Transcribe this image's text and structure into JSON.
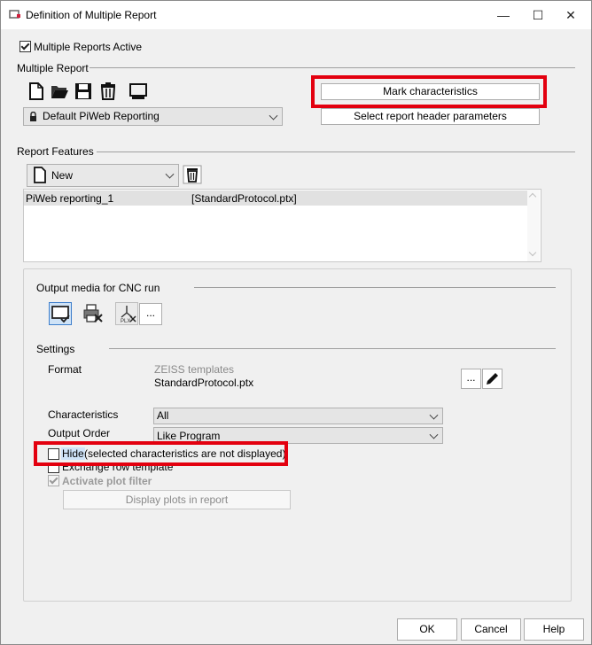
{
  "window": {
    "title": "Definition of Multiple Report",
    "minimize": "—",
    "maximize": "☐",
    "close": "✕"
  },
  "multiple_reports_active": {
    "label": "Multiple Reports Active",
    "checked": true
  },
  "multiple_report": {
    "section_label": "Multiple Report",
    "toolbar_icons": [
      "new-document-icon",
      "open-folder-icon",
      "save-icon",
      "delete-icon",
      "monitor-icon"
    ],
    "selected_report": "Default PiWeb Reporting",
    "mark_characteristics": "Mark characteristics",
    "select_header_params": "Select report header parameters"
  },
  "report_features": {
    "section_label": "Report Features",
    "new_combo": "New",
    "list": [
      {
        "name": "PiWeb reporting_1",
        "template": "[StandardProtocol.ptx]"
      }
    ]
  },
  "output_media": {
    "section_label": "Output media for CNC run",
    "icons": [
      "screen-output-icon",
      "printer-off-icon",
      "plx-export-icon"
    ],
    "more": "..."
  },
  "settings": {
    "section_label": "Settings",
    "format_label": "Format",
    "format_group": "ZEISS templates",
    "format_file": "StandardProtocol.ptx",
    "format_more": "...",
    "characteristics_label": "Characteristics",
    "characteristics_value": "All",
    "output_order_label": "Output Order",
    "output_order_value": "Like Program",
    "hide_word": "Hide",
    "hide_rest": " (selected characteristics are not displayed)",
    "exchange_label": "Exchange row template",
    "activate_plot_label": "Activate plot filter",
    "display_plots": "Display plots in report"
  },
  "footer": {
    "ok": "OK",
    "cancel": "Cancel",
    "help": "Help"
  },
  "colors": {
    "highlight": "#e3000f",
    "selection": "#cfe3f7",
    "list_selected": "#e1e1e1"
  }
}
